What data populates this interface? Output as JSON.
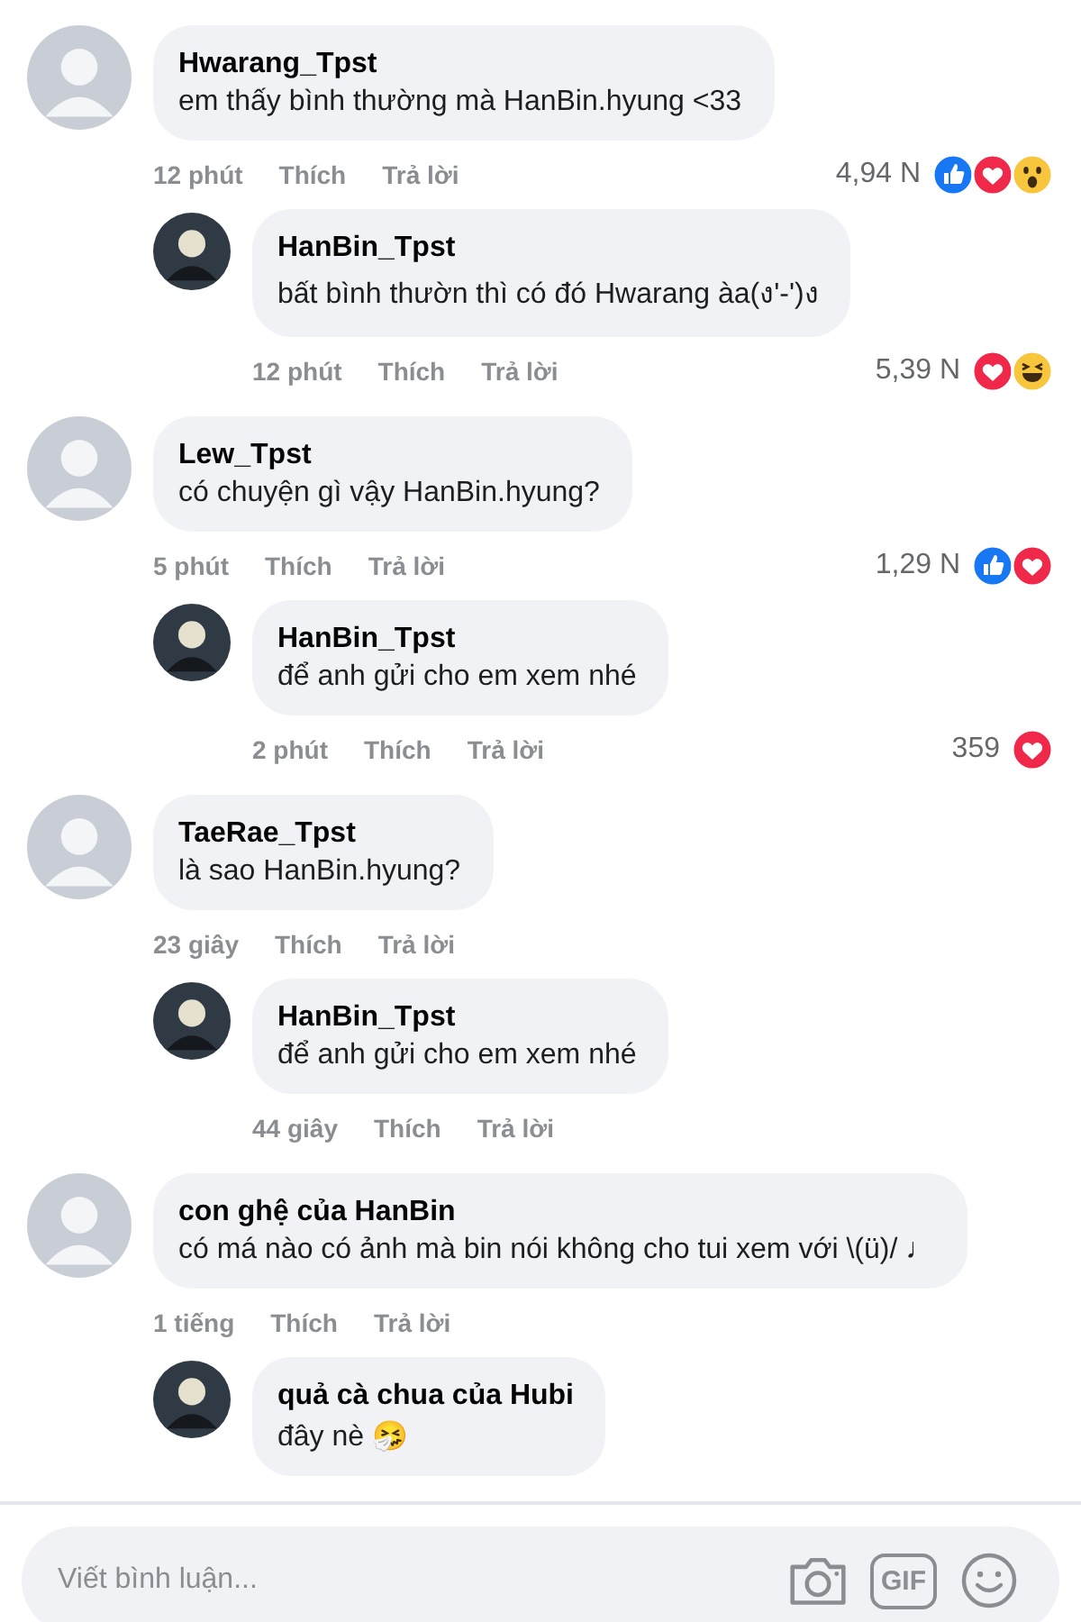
{
  "comments": [
    {
      "author": "Hwarang_Tpst",
      "text": "em thấy bình thường mà HanBin.hyung <33",
      "time": "12 phút",
      "like_label": "Thích",
      "reply_label": "Trả lời",
      "reaction_count": "4,94 N",
      "reactions": [
        {
          "kind": "like"
        },
        {
          "kind": "love"
        },
        {
          "kind": "wow"
        }
      ],
      "children": [
        {
          "author": "HanBin_Tpst",
          "text": "bất bình thườn thì có đó Hwarang àa(ง'-')ง",
          "time": "12 phút",
          "like_label": "Thích",
          "reply_label": "Trả lời",
          "reaction_count": "5,39 N",
          "reactions": [
            {
              "kind": "love"
            },
            {
              "kind": "haha"
            }
          ]
        }
      ]
    },
    {
      "author": "Lew_Tpst",
      "text": "có chuyện gì vậy HanBin.hyung?",
      "time": "5 phút",
      "like_label": "Thích",
      "reply_label": "Trả lời",
      "reaction_count": "1,29 N",
      "reactions": [
        {
          "kind": "like"
        },
        {
          "kind": "love"
        }
      ],
      "children": [
        {
          "author": "HanBin_Tpst",
          "text": "để anh gửi cho em xem nhé",
          "time": "2 phút",
          "like_label": "Thích",
          "reply_label": "Trả lời",
          "reaction_count": "359",
          "reactions": [
            {
              "kind": "love"
            }
          ]
        }
      ]
    },
    {
      "author": "TaeRae_Tpst",
      "text": "là sao HanBin.hyung?",
      "time": "23 giây",
      "like_label": "Thích",
      "reply_label": "Trả lời",
      "children": [
        {
          "author": "HanBin_Tpst",
          "text": "để anh gửi cho em xem nhé",
          "time": "44 giây",
          "like_label": "Thích",
          "reply_label": "Trả lời"
        }
      ]
    },
    {
      "author": "con ghệ của HanBin",
      "text": "có má nào có ảnh mà bin nói không cho tui xem với \\(ü)/ ♩",
      "time": "1 tiếng",
      "like_label": "Thích",
      "reply_label": "Trả lời",
      "children": [
        {
          "author": "quả cà chua của Hubi",
          "text": "đây nè 🤧"
        }
      ]
    }
  ],
  "composer": {
    "placeholder": "Viết bình luận...",
    "gif_label": "GIF"
  }
}
